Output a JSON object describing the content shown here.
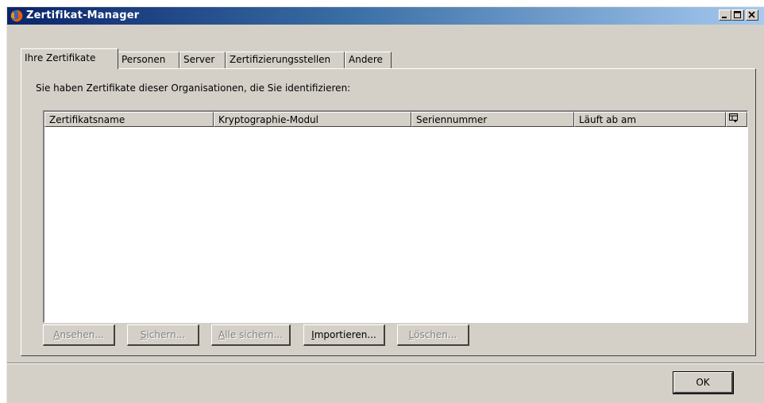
{
  "window": {
    "title": "Zertifikat-Manager",
    "title_icon": "firefox-icon",
    "buttons": [
      "minimize-icon",
      "maximize-icon",
      "close-icon"
    ]
  },
  "tabs": [
    {
      "label": "Ihre Zertifikate",
      "active": true
    },
    {
      "label": "Personen",
      "active": false
    },
    {
      "label": "Server",
      "active": false
    },
    {
      "label": "Zertifizierungsstellen",
      "active": false
    },
    {
      "label": "Andere",
      "active": false
    }
  ],
  "panel": {
    "description": "Sie haben Zertifikate dieser Organisationen, die Sie identifizieren:"
  },
  "table": {
    "columns": [
      "Zertifikatsname",
      "Kryptographie-Modul",
      "Seriennummer",
      "Läuft ab am"
    ],
    "column_picker_icon": "column-picker-icon",
    "rows": []
  },
  "actions": {
    "view": {
      "pre": "",
      "u": "A",
      "post": "nsehen...",
      "enabled": false
    },
    "backup": {
      "pre": "",
      "u": "S",
      "post": "ichern...",
      "enabled": false
    },
    "backup_all": {
      "pre": "",
      "u": "A",
      "post": "lle sichern...",
      "enabled": false
    },
    "import": {
      "pre": "",
      "u": "I",
      "post": "mportieren...",
      "enabled": true
    },
    "delete": {
      "pre": "",
      "u": "L",
      "post": "öschen...",
      "enabled": false
    }
  },
  "footer": {
    "ok_label": "OK"
  },
  "colors": {
    "dialog_bg": "#d4d0c8",
    "title_gradient_start": "#0a246a",
    "title_gradient_end": "#a6caf0",
    "disabled_text": "#808080"
  }
}
